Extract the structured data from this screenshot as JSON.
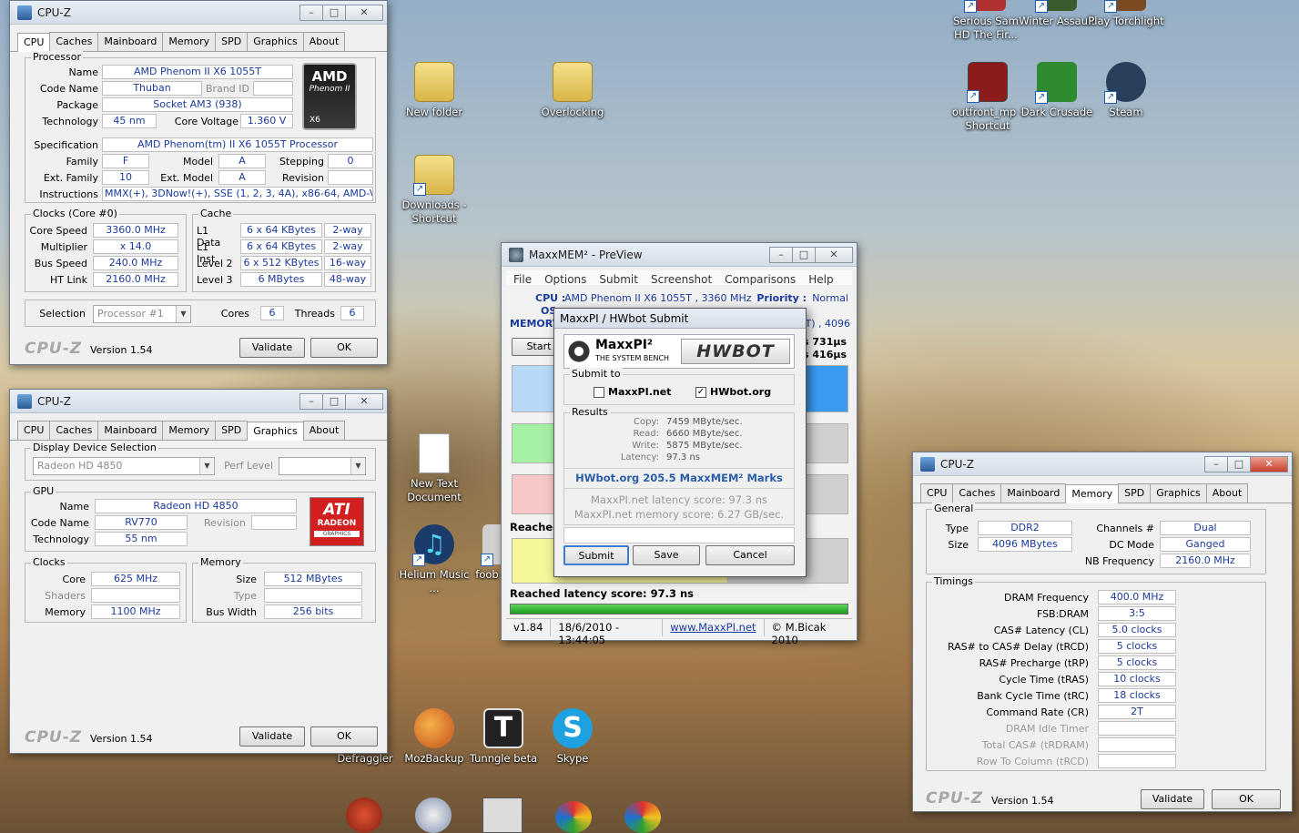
{
  "desktop": {
    "icons": [
      {
        "id": "serious-sam",
        "label": "Serious Sam HD The Fir...",
        "color": "#b03030"
      },
      {
        "id": "winter-assault",
        "label": "Winter Assault",
        "color": "#3a5c2c"
      },
      {
        "id": "play-torchlight",
        "label": "Play Torchlight",
        "color": "#7a4a20"
      },
      {
        "id": "new-folder",
        "label": "New folder",
        "color": "#e6c65c"
      },
      {
        "id": "overlocking",
        "label": "Overlocking",
        "color": "#e6c65c"
      },
      {
        "id": "outfront",
        "label": "outfront_mp - Shortcut",
        "color": "#8c1c1c"
      },
      {
        "id": "dark-crusade",
        "label": "Dark Crusade",
        "color": "#2e8a2e"
      },
      {
        "id": "steam",
        "label": "Steam",
        "color": "#2a3f5c"
      },
      {
        "id": "downloads",
        "label": "Downloads - Shortcut",
        "color": "#e6c65c"
      },
      {
        "id": "new-text-document",
        "label": "New Text Document",
        "color": "#ffffff"
      },
      {
        "id": "helium-music",
        "label": "Helium Music ...",
        "color": "#1b3c6b"
      },
      {
        "id": "foob",
        "label": "foob",
        "color": "#d0d0d0"
      },
      {
        "id": "defraggler",
        "label": "Defraggler",
        "color": "#c04020"
      },
      {
        "id": "mozbackup",
        "label": "MozBackup",
        "color": "#d86a1a"
      },
      {
        "id": "tunngle",
        "label": "Tunngle beta",
        "color": "#222222"
      },
      {
        "id": "skype",
        "label": "Skype",
        "color": "#1da1e0"
      }
    ]
  },
  "cpuz_cpu": {
    "title": "CPU-Z",
    "tabs": [
      "CPU",
      "Caches",
      "Mainboard",
      "Memory",
      "SPD",
      "Graphics",
      "About"
    ],
    "processor_group": "Processor",
    "labels": {
      "name": "Name",
      "code_name": "Code Name",
      "brand_id": "Brand ID",
      "package": "Package",
      "technology": "Technology",
      "core_voltage": "Core Voltage",
      "specification": "Specification",
      "family": "Family",
      "model": "Model",
      "stepping": "Stepping",
      "ext_family": "Ext. Family",
      "ext_model": "Ext. Model",
      "revision": "Revision",
      "instructions": "Instructions"
    },
    "values": {
      "name": "AMD Phenom II X6 1055T",
      "code_name": "Thuban",
      "package": "Socket AM3 (938)",
      "technology": "45 nm",
      "core_voltage": "1.360 V",
      "specification": "AMD Phenom(tm) II X6 1055T Processor",
      "family": "F",
      "model": "A",
      "stepping": "0",
      "ext_family": "10",
      "ext_model": "A",
      "revision": "",
      "instructions": "MMX(+), 3DNow!(+), SSE (1, 2, 3, 4A), x86-64, AMD-V"
    },
    "logo": {
      "brand": "AMD",
      "line": "Phenom II",
      "badge": "X6"
    },
    "clocks_group": "Clocks (Core #0)",
    "clocks": {
      "core_speed_label": "Core Speed",
      "core_speed": "3360.0 MHz",
      "multiplier_label": "Multiplier",
      "multiplier": "x 14.0",
      "bus_speed_label": "Bus Speed",
      "bus_speed": "240.0 MHz",
      "ht_link_label": "HT Link",
      "ht_link": "2160.0 MHz"
    },
    "cache_group": "Cache",
    "cache": [
      {
        "label": "L1 Data",
        "size": "6 x 64 KBytes",
        "way": "2-way"
      },
      {
        "label": "L1 Inst.",
        "size": "6 x 64 KBytes",
        "way": "2-way"
      },
      {
        "label": "Level 2",
        "size": "6 x 512 KBytes",
        "way": "16-way"
      },
      {
        "label": "Level 3",
        "size": "6 MBytes",
        "way": "48-way"
      }
    ],
    "selection_label": "Selection",
    "selection_value": "Processor #1",
    "cores_label": "Cores",
    "cores": "6",
    "threads_label": "Threads",
    "threads": "6",
    "logo_text": "CPU-Z",
    "version": "Version 1.54",
    "validate": "Validate",
    "ok": "OK"
  },
  "cpuz_graphics": {
    "title": "CPU-Z",
    "tabs": [
      "CPU",
      "Caches",
      "Mainboard",
      "Memory",
      "SPD",
      "Graphics",
      "About"
    ],
    "display_group": "Display Device Selection",
    "device": "Radeon HD 4850",
    "perf_level_label": "Perf Level",
    "gpu_group": "GPU",
    "name_label": "Name",
    "name": "Radeon HD 4850",
    "code_name_label": "Code Name",
    "code_name": "RV770",
    "revision_label": "Revision",
    "technology_label": "Technology",
    "technology": "55 nm",
    "logo": {
      "brand": "ATI",
      "line": "RADEON",
      "sub": "GRAPHICS"
    },
    "clocks_group": "Clocks",
    "core_label": "Core",
    "core": "625 MHz",
    "shaders_label": "Shaders",
    "memory_clk_label": "Memory",
    "memory_clk": "1100 MHz",
    "memory_group": "Memory",
    "size_label": "Size",
    "size": "512 MBytes",
    "type_label": "Type",
    "bus_width_label": "Bus Width",
    "bus_width": "256 bits",
    "logo_text": "CPU-Z",
    "version": "Version 1.54",
    "validate": "Validate",
    "ok": "OK"
  },
  "maxxmem": {
    "title": "MaxxMEM² - PreView",
    "menu": [
      "File",
      "Options",
      "Submit",
      "Screenshot",
      "Comparisons",
      "Help"
    ],
    "cpu_label": "CPU :",
    "cpu_value": "AMD Phenom II X6 1055T , 3360 MHz",
    "priority_label": "Priority :",
    "priority_value": "Normal",
    "os_label": "OS",
    "memory_label": "MEMORY",
    "memory_tail": "2T) , 4096",
    "start_button": "Start",
    "lat_top": "s 731µs",
    "lat_bottom": "s 416µs",
    "reached_short": "Reached",
    "reached_latency": "Reached latency score: 97.3 ns",
    "status": {
      "version": "v1.84",
      "datetime": "18/6/2010 - 13:44:05",
      "site": "www.MaxxPI.net",
      "author": "© M.Bicak 2010"
    }
  },
  "hwbot_dialog": {
    "title": "MaxxPI / HWbot Submit",
    "brand_left": "MaxxPI²",
    "brand_left_sub": "THE SYSTEM BENCH",
    "brand_right": "HWBOT",
    "submit_to": "Submit to",
    "option_maxxpi": "MaxxPI.net",
    "option_hwbot": "HWbot.org",
    "results_label": "Results",
    "results": [
      {
        "label": "Copy:",
        "value": "7459 MByte/sec."
      },
      {
        "label": "Read:",
        "value": "6660 MByte/sec."
      },
      {
        "label": "Write:",
        "value": "5875 MByte/sec."
      },
      {
        "label": "Latency:",
        "value": "97.3 ns"
      }
    ],
    "hwbot_score": "HWbot.org  205.5  MaxxMEM² Marks",
    "latency_score": "MaxxPI.net latency score:  97.3  ns",
    "memory_score": "MaxxPI.net memory score:  6.27  GB/sec.",
    "submit": "Submit",
    "save": "Save",
    "cancel": "Cancel"
  },
  "cpuz_memory": {
    "title": "CPU-Z",
    "tabs": [
      "CPU",
      "Caches",
      "Mainboard",
      "Memory",
      "SPD",
      "Graphics",
      "About"
    ],
    "general_group": "General",
    "type_label": "Type",
    "type": "DDR2",
    "size_label": "Size",
    "size": "4096 MBytes",
    "channels_label": "Channels #",
    "channels": "Dual",
    "dc_mode_label": "DC Mode",
    "dc_mode": "Ganged",
    "nb_freq_label": "NB Frequency",
    "nb_freq": "2160.0 MHz",
    "timings_group": "Timings",
    "timings": [
      {
        "label": "DRAM Frequency",
        "value": "400.0 MHz",
        "grey": false
      },
      {
        "label": "FSB:DRAM",
        "value": "3:5",
        "grey": false
      },
      {
        "label": "CAS# Latency (CL)",
        "value": "5.0 clocks",
        "grey": false
      },
      {
        "label": "RAS# to CAS# Delay (tRCD)",
        "value": "5 clocks",
        "grey": false
      },
      {
        "label": "RAS# Precharge (tRP)",
        "value": "5 clocks",
        "grey": false
      },
      {
        "label": "Cycle Time (tRAS)",
        "value": "10 clocks",
        "grey": false
      },
      {
        "label": "Bank Cycle Time (tRC)",
        "value": "18 clocks",
        "grey": false
      },
      {
        "label": "Command Rate (CR)",
        "value": "2T",
        "grey": false
      },
      {
        "label": "DRAM Idle Timer",
        "value": "",
        "grey": true
      },
      {
        "label": "Total CAS# (tRDRAM)",
        "value": "",
        "grey": true
      },
      {
        "label": "Row To Column (tRCD)",
        "value": "",
        "grey": true
      }
    ],
    "logo_text": "CPU-Z",
    "version": "Version 1.54",
    "validate": "Validate",
    "ok": "OK"
  }
}
